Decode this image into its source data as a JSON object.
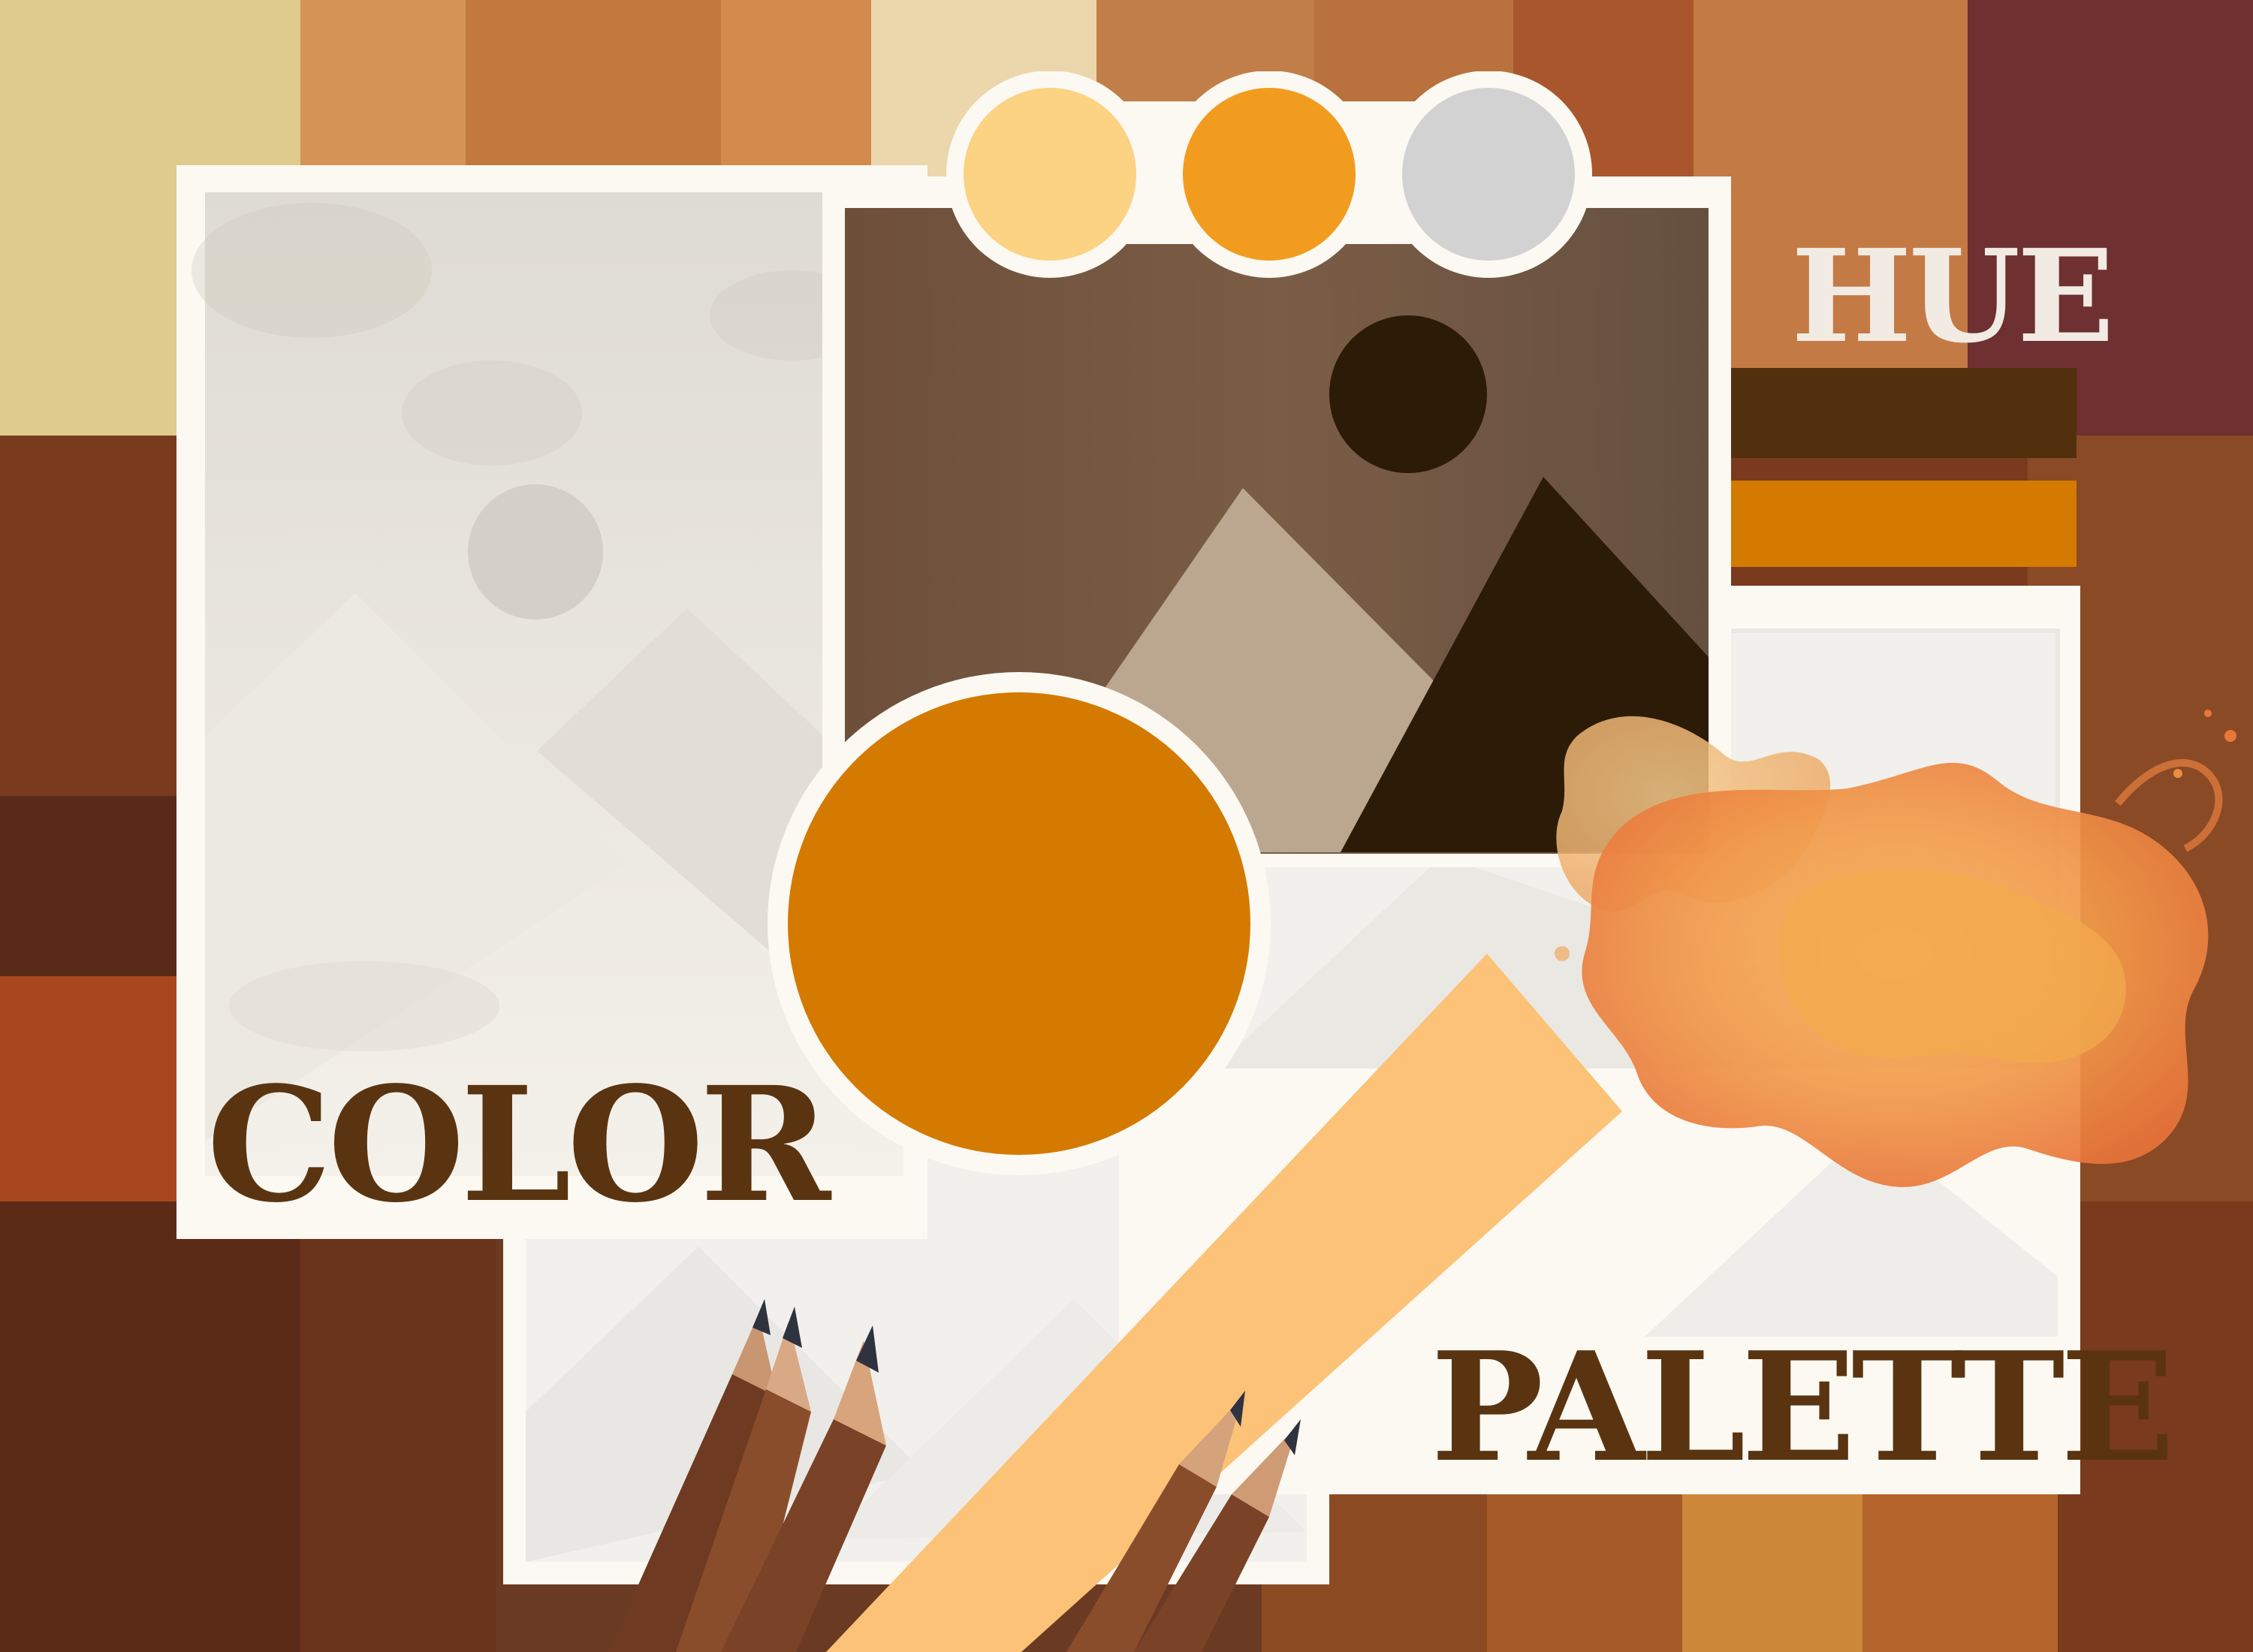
{
  "titles": {
    "hue": "HUE",
    "color": "COLOR",
    "palette": "PALETTE"
  },
  "swatches": {
    "top_row": [
      {
        "name": "light-orange",
        "hex": "#fcd283"
      },
      {
        "name": "orange",
        "hex": "#f29c1f"
      },
      {
        "name": "silver",
        "hex": "#d2d2d3"
      }
    ],
    "bars": [
      {
        "name": "dark-brown",
        "hex": "#52300d"
      },
      {
        "name": "amber",
        "hex": "#d47a00"
      }
    ],
    "large_circle": {
      "name": "deep-orange",
      "hex": "#d47a00"
    },
    "diagonal_band": {
      "name": "peach",
      "hex": "#fcc277"
    }
  },
  "colors": {
    "title_brown": "#5a3411",
    "hue_text": "#f1ebe3",
    "card_white": "#fbf9f2"
  },
  "icons": [
    "image-placeholder-icon",
    "paint-splash-icon",
    "pencil-icon"
  ]
}
